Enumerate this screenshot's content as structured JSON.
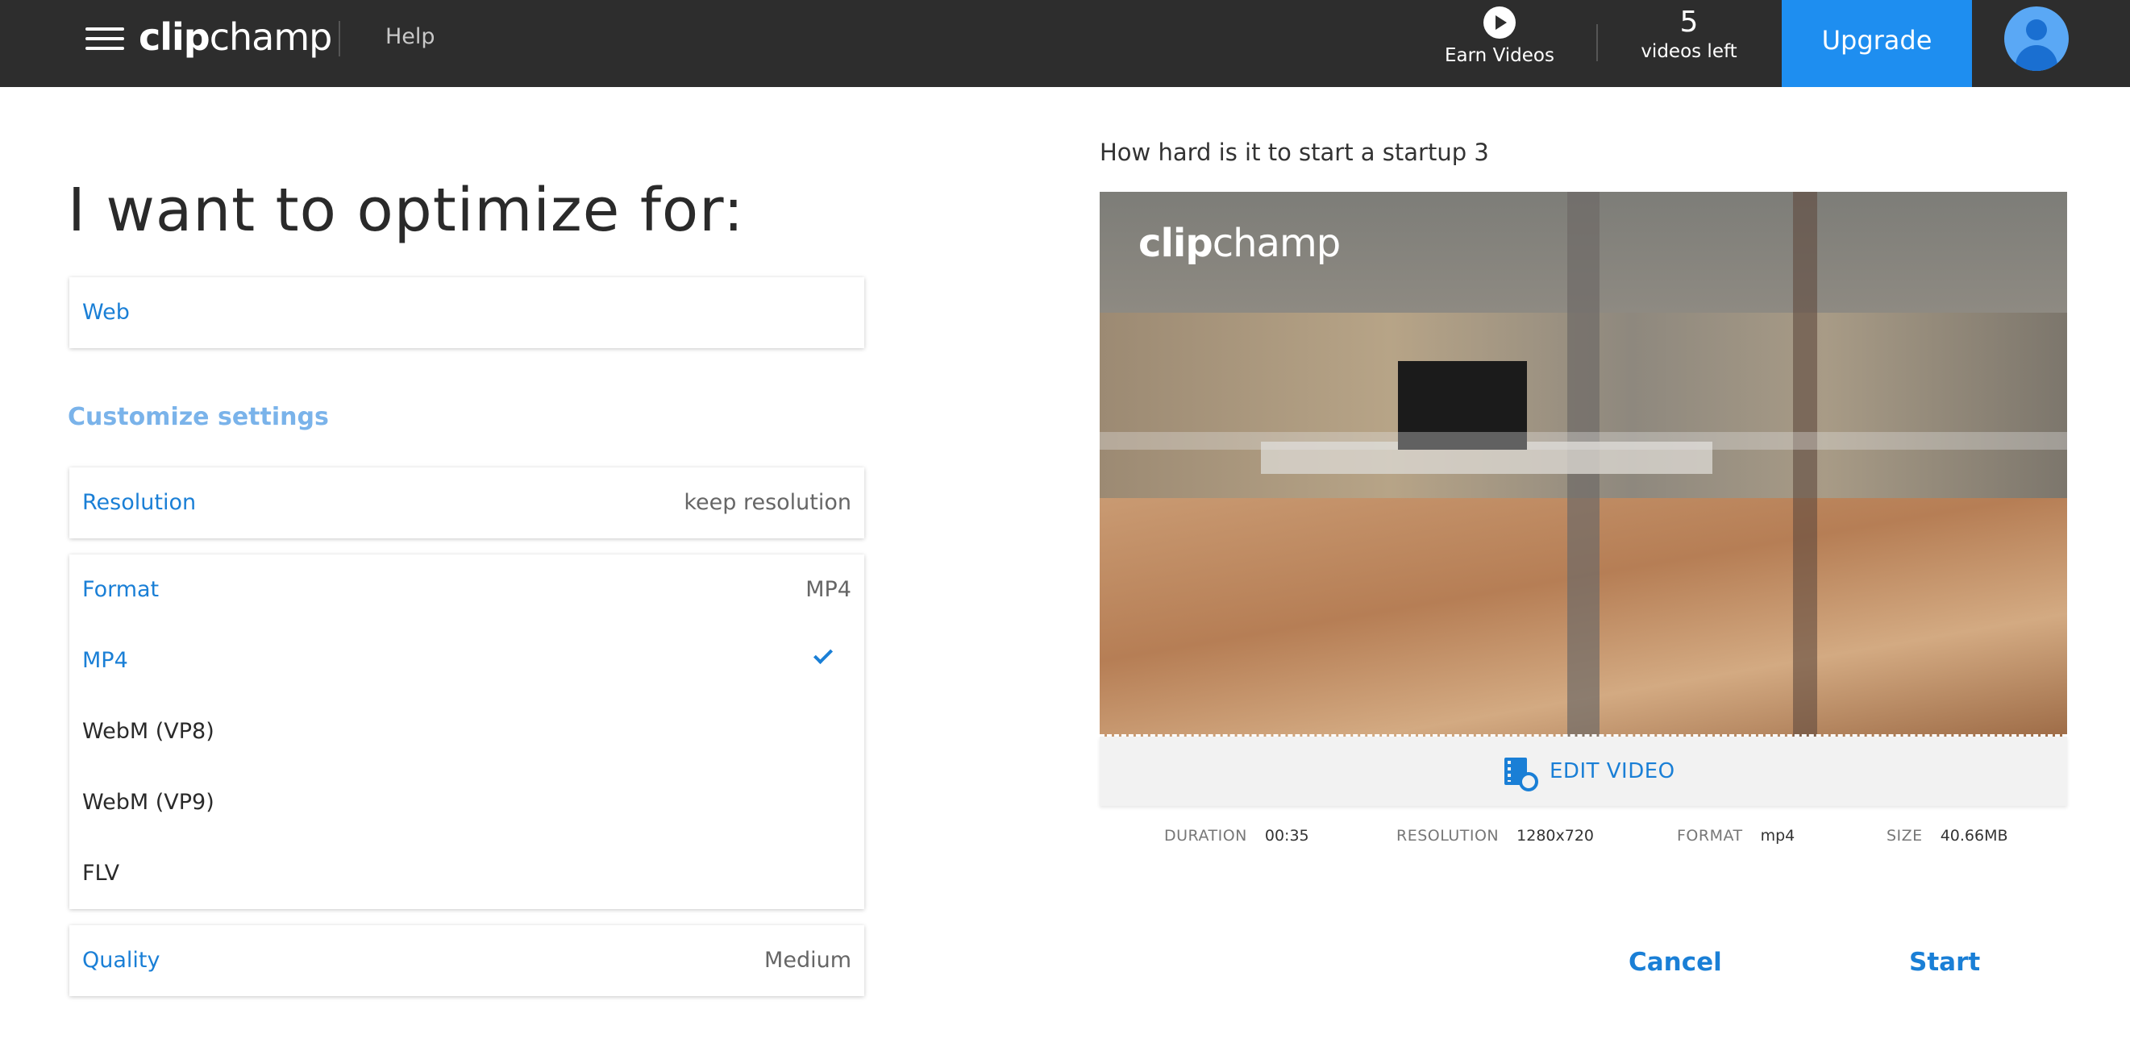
{
  "header": {
    "logo_clip": "clip",
    "logo_champ": "champ",
    "help": "Help",
    "earn_videos": "Earn Videos",
    "videos_count": "5",
    "videos_left_label": "videos left",
    "upgrade": "Upgrade"
  },
  "main": {
    "title": "I want to optimize for:",
    "optimize_option": "Web",
    "customize_label": "Customize settings",
    "resolution": {
      "label": "Resolution",
      "value": "keep resolution"
    },
    "format": {
      "label": "Format",
      "value": "MP4",
      "options": [
        {
          "label": "MP4",
          "selected": true
        },
        {
          "label": "WebM (VP8)",
          "selected": false
        },
        {
          "label": "WebM (VP9)",
          "selected": false
        },
        {
          "label": "FLV",
          "selected": false
        }
      ]
    },
    "quality": {
      "label": "Quality",
      "value": "Medium"
    }
  },
  "preview": {
    "title": "How hard is it to start a startup 3",
    "watermark_clip": "clip",
    "watermark_champ": "champ",
    "edit_video": "EDIT VIDEO",
    "meta": {
      "duration_label": "DURATION",
      "duration": "00:35",
      "resolution_label": "RESOLUTION",
      "resolution": "1280x720",
      "format_label": "FORMAT",
      "format": "mp4",
      "size_label": "SIZE",
      "size": "40.66MB"
    }
  },
  "actions": {
    "cancel": "Cancel",
    "start": "Start"
  },
  "colors": {
    "topbar": "#2d2d2d",
    "accent": "#1e8ef0",
    "link": "#1a7fd6",
    "customize": "#7ab3ea"
  }
}
